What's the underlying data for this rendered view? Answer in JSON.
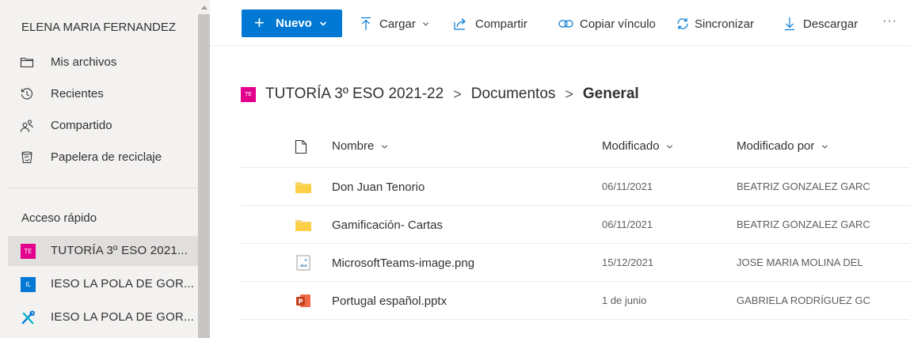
{
  "sidebar": {
    "user_name": "ELENA MARIA FERNANDEZ",
    "nav": [
      {
        "label": "Mis archivos",
        "icon": "folder-icon"
      },
      {
        "label": "Recientes",
        "icon": "history-icon"
      },
      {
        "label": "Compartido",
        "icon": "people-icon"
      },
      {
        "label": "Papelera de reciclaje",
        "icon": "recycle-bin-icon"
      }
    ],
    "quick_access_title": "Acceso rápido",
    "quick_access": [
      {
        "label": "TUTORÍA 3º ESO 2021...",
        "badge": "TE",
        "badge_color": "#e3008c",
        "selected": true
      },
      {
        "label": "IESO LA POLA DE GOR...",
        "badge": "IL",
        "badge_color": "#0078d4",
        "selected": false
      },
      {
        "label": "IESO LA POLA DE GOR...",
        "badge": "tools-icon",
        "badge_color": "#0078d4",
        "selected": false
      }
    ]
  },
  "toolbar": {
    "new_label": "Nuevo",
    "upload_label": "Cargar",
    "share_label": "Compartir",
    "copy_link_label": "Copiar vínculo",
    "sync_label": "Sincronizar",
    "download_label": "Descargar",
    "more_label": "···"
  },
  "breadcrumb": {
    "site_badge": "TE",
    "site": "TUTORÍA 3º ESO 2021-22",
    "library": "Documentos",
    "current": "General",
    "separator": ">"
  },
  "list": {
    "columns": {
      "name": "Nombre",
      "modified": "Modificado",
      "modified_by": "Modificado por"
    },
    "rows": [
      {
        "type": "folder",
        "name": "Don Juan Tenorio",
        "modified": "06/11/2021",
        "modified_by": "BEATRIZ GONZALEZ GARC"
      },
      {
        "type": "folder",
        "name": "Gamificación- Cartas",
        "modified": "06/11/2021",
        "modified_by": "BEATRIZ GONZALEZ GARC"
      },
      {
        "type": "image",
        "name": "MicrosoftTeams-image.png",
        "modified": "15/12/2021",
        "modified_by": "JOSE MARIA MOLINA DEL"
      },
      {
        "type": "pptx",
        "name": "Portugal español.pptx",
        "modified": "1 de junio",
        "modified_by": "GABRIELA RODRÍGUEZ GC"
      }
    ]
  },
  "colors": {
    "accent": "#0078d4",
    "site_pink": "#e3008c",
    "folder": "#f8d775",
    "pptx": "#c43e1c"
  }
}
